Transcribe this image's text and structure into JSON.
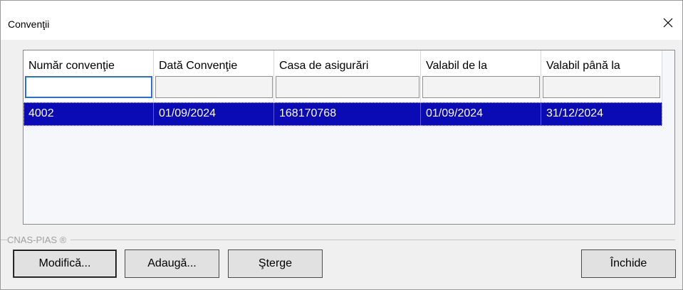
{
  "window": {
    "title": "Convenţii"
  },
  "grid": {
    "columns": [
      {
        "label": "Număr convenţie"
      },
      {
        "label": "Dată Convenţie"
      },
      {
        "label": "Casa de asigurări"
      },
      {
        "label": "Valabil de la"
      },
      {
        "label": "Valabil până la"
      }
    ],
    "filters": [
      "",
      "",
      "",
      "",
      ""
    ],
    "rows": [
      [
        "4002",
        "01/09/2024",
        "168170768",
        "01/09/2024",
        "31/12/2024"
      ]
    ],
    "selected_row_color": "#0b0bb5"
  },
  "group": {
    "label": "CNAS-PIAS ®"
  },
  "buttons": {
    "edit": "Modifică...",
    "add": "Adaugă...",
    "delete": "Şterge",
    "close": "Închide"
  },
  "icons": {
    "close": "close-x-icon"
  }
}
